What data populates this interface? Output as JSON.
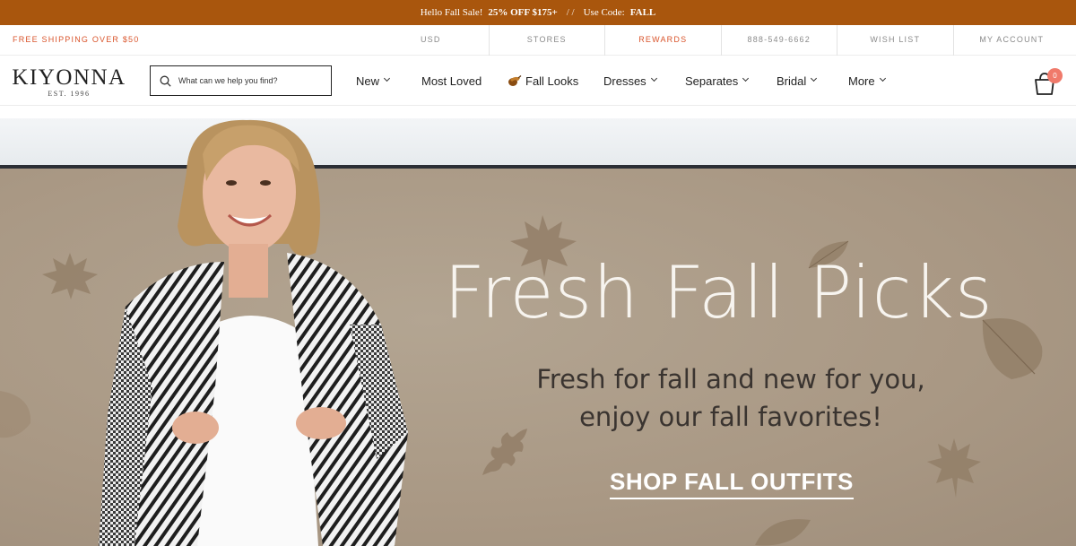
{
  "promo": {
    "hello": "Hello Fall Sale!",
    "offer": "25% OFF $175+",
    "separator": "/ /",
    "code_label": "Use Code:",
    "code": "FALL"
  },
  "utility": {
    "shipping": "FREE SHIPPING OVER $50",
    "links": [
      "USD",
      "STORES",
      "REWARDS",
      "888-549-6662",
      "WISH LIST",
      "MY ACCOUNT"
    ],
    "accent_color": "#d9542b"
  },
  "brand": {
    "name": "KIYONNA",
    "est": "EST. 1996"
  },
  "search": {
    "placeholder": "What can we help you find?"
  },
  "nav": {
    "items": [
      "New",
      "Most Loved",
      "Fall Looks",
      "Dresses",
      "Separates",
      "Bridal",
      "More"
    ]
  },
  "cart": {
    "count": "0"
  },
  "hero": {
    "title": "Fresh Fall Picks",
    "subtitle_line1": "Fresh for fall and new for you,",
    "subtitle_line2": "enjoy our fall favorites!",
    "cta": "SHOP FALL OUTFITS"
  },
  "colors": {
    "promo_bg": "#a9560d",
    "hero_bg": "#ad9d8a",
    "badge": "#f07a6b"
  }
}
